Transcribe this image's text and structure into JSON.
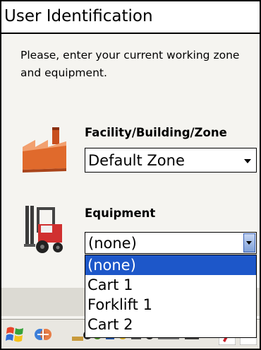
{
  "window": {
    "title": "User Identification"
  },
  "instructions": "Please, enter your current working zone and equipment.",
  "facility": {
    "label": "Facility/Building/Zone",
    "selected": "Default Zone",
    "icon": "factory-icon"
  },
  "equipment": {
    "label": "Equipment",
    "selected": "(none)",
    "icon": "forklift-icon",
    "options": [
      "(none)",
      "Cart 1",
      "Forklift 1",
      "Cart 2"
    ],
    "highlighted_index": 0
  },
  "taskbar": {
    "icons": [
      "windows-start-icon",
      "network-icon",
      "tray-icons",
      "pen-icon",
      "menu-icon"
    ]
  },
  "colors": {
    "selection": "#1d57c9",
    "factory": "#e06a2c"
  }
}
